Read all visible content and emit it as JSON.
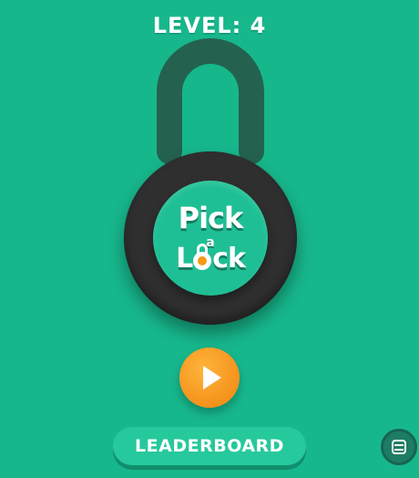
{
  "header": {
    "level_text": "LEVEL: 4"
  },
  "logo": {
    "line1": "Pick",
    "connector": "a",
    "line2_start": "L",
    "line2_end": "ck"
  },
  "buttons": {
    "play_icon": "play-icon",
    "leaderboard_label": "LEADERBOARD",
    "menu_icon": "menu-icon"
  },
  "colors": {
    "background": "#17b78c",
    "shackle": "#24624f",
    "lock_body": "#2f2f2f",
    "dial": "#1fbf95",
    "play": "#f59a16",
    "leaderboard": "#26c99b"
  }
}
